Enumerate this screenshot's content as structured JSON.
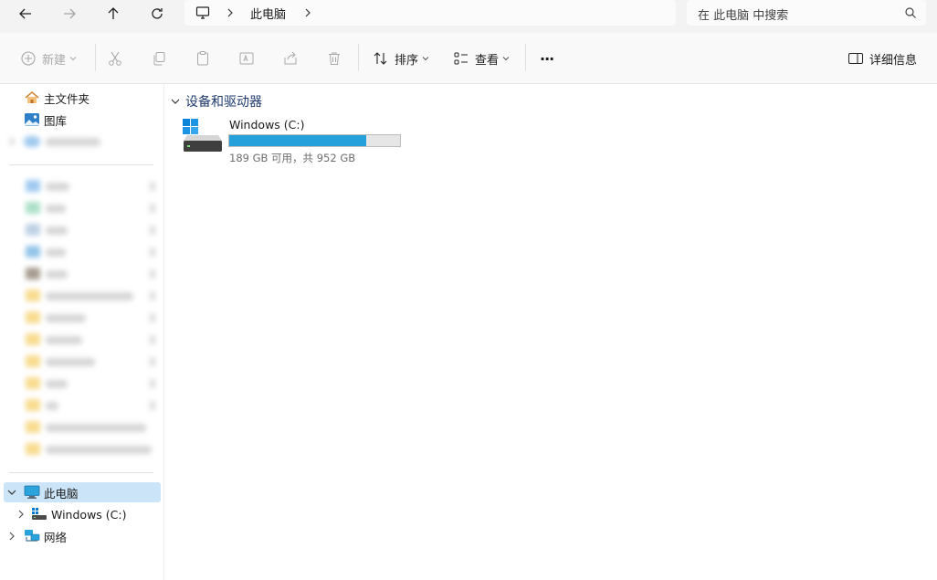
{
  "address": {
    "breadcrumb": [
      "此电脑"
    ],
    "search_placeholder": "在 此电脑 中搜索"
  },
  "toolbar": {
    "new_label": "新建",
    "sort_label": "排序",
    "view_label": "查看",
    "more_label": "···",
    "details_label": "详细信息"
  },
  "sidebar": {
    "quick": [
      {
        "label": "主文件夹",
        "icon": "home-icon"
      },
      {
        "label": "图库",
        "icon": "gallery-icon"
      }
    ],
    "this_pc": "此电脑",
    "drive": "Windows  (C:)",
    "network": "网络"
  },
  "content": {
    "group_title": "设备和驱动器",
    "drive": {
      "name": "Windows  (C:)",
      "space_text": "189 GB 可用，共 952 GB",
      "used_fraction": 0.801,
      "bar_color": "#26a0da"
    }
  },
  "colors": {
    "accent": "#26a0da",
    "selection": "#cce4f7",
    "group_header": "#1e3a6e"
  }
}
